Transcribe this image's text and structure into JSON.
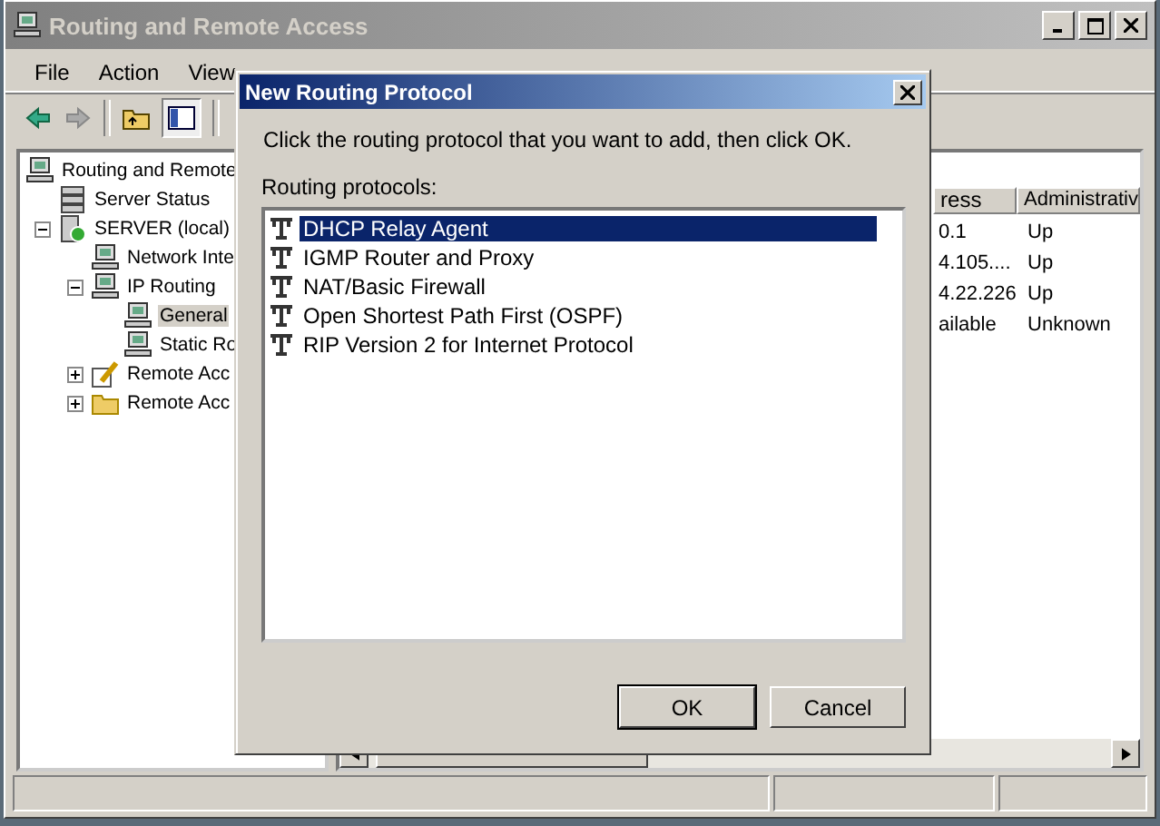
{
  "window": {
    "title": "Routing and Remote Access"
  },
  "menu": [
    {
      "label": "File"
    },
    {
      "label": "Action"
    },
    {
      "label": "View"
    }
  ],
  "tree": [
    {
      "label": "Routing and Remote",
      "kind": "computer",
      "selected": false,
      "children": [
        {
          "label": "Server Status",
          "kind": "servers",
          "selected": false
        },
        {
          "label": "SERVER (local)",
          "kind": "server",
          "selected": false,
          "expanded": true,
          "children": [
            {
              "label": "Network Inte",
              "kind": "computer",
              "selected": false
            },
            {
              "label": "IP Routing",
              "kind": "computer",
              "selected": false,
              "expanded": true,
              "children": [
                {
                  "label": "General",
                  "kind": "computer",
                  "selected": true
                },
                {
                  "label": "Static Ro",
                  "kind": "computer",
                  "selected": false
                }
              ]
            },
            {
              "label": "Remote Acc",
              "kind": "policy",
              "selected": false,
              "expanded": false
            },
            {
              "label": "Remote Acc",
              "kind": "folder",
              "selected": false,
              "expanded": false
            }
          ]
        }
      ]
    }
  ],
  "list": {
    "columns": [
      "ress",
      "Administrativ"
    ],
    "rows": [
      [
        "0.1",
        "Up"
      ],
      [
        "4.105....",
        "Up"
      ],
      [
        "4.22.226",
        "Up"
      ],
      [
        "ailable",
        "Unknown"
      ]
    ]
  },
  "dialog": {
    "title": "New Routing Protocol",
    "prompt": "Click the routing protocol that you want to add, then click OK.",
    "list_label": "Routing protocols:",
    "protocols": [
      {
        "label": "DHCP Relay Agent",
        "selected": true
      },
      {
        "label": "IGMP Router and Proxy",
        "selected": false
      },
      {
        "label": "NAT/Basic Firewall",
        "selected": false
      },
      {
        "label": "Open Shortest Path First (OSPF)",
        "selected": false
      },
      {
        "label": "RIP Version 2 for Internet Protocol",
        "selected": false
      }
    ],
    "buttons": [
      {
        "label": "OK",
        "default": true
      },
      {
        "label": "Cancel",
        "default": false
      }
    ]
  }
}
